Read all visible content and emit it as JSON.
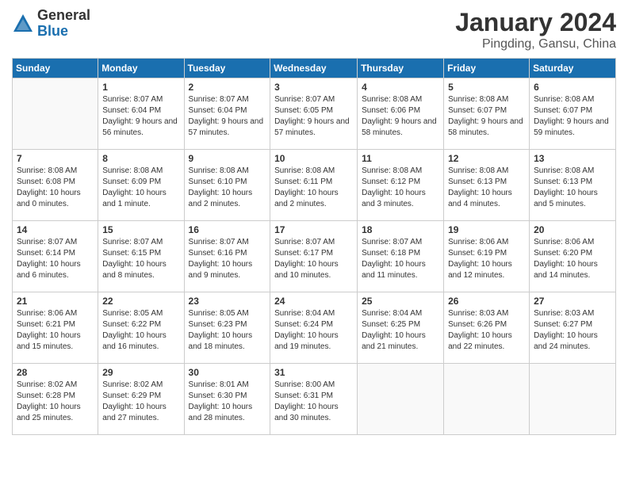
{
  "header": {
    "logo_general": "General",
    "logo_blue": "Blue",
    "title": "January 2024",
    "location": "Pingding, Gansu, China"
  },
  "weekdays": [
    "Sunday",
    "Monday",
    "Tuesday",
    "Wednesday",
    "Thursday",
    "Friday",
    "Saturday"
  ],
  "weeks": [
    [
      {
        "day": "",
        "sunrise": "",
        "sunset": "",
        "daylight": ""
      },
      {
        "day": "1",
        "sunrise": "Sunrise: 8:07 AM",
        "sunset": "Sunset: 6:04 PM",
        "daylight": "Daylight: 9 hours and 56 minutes."
      },
      {
        "day": "2",
        "sunrise": "Sunrise: 8:07 AM",
        "sunset": "Sunset: 6:04 PM",
        "daylight": "Daylight: 9 hours and 57 minutes."
      },
      {
        "day": "3",
        "sunrise": "Sunrise: 8:07 AM",
        "sunset": "Sunset: 6:05 PM",
        "daylight": "Daylight: 9 hours and 57 minutes."
      },
      {
        "day": "4",
        "sunrise": "Sunrise: 8:08 AM",
        "sunset": "Sunset: 6:06 PM",
        "daylight": "Daylight: 9 hours and 58 minutes."
      },
      {
        "day": "5",
        "sunrise": "Sunrise: 8:08 AM",
        "sunset": "Sunset: 6:07 PM",
        "daylight": "Daylight: 9 hours and 58 minutes."
      },
      {
        "day": "6",
        "sunrise": "Sunrise: 8:08 AM",
        "sunset": "Sunset: 6:07 PM",
        "daylight": "Daylight: 9 hours and 59 minutes."
      }
    ],
    [
      {
        "day": "7",
        "sunrise": "Sunrise: 8:08 AM",
        "sunset": "Sunset: 6:08 PM",
        "daylight": "Daylight: 10 hours and 0 minutes."
      },
      {
        "day": "8",
        "sunrise": "Sunrise: 8:08 AM",
        "sunset": "Sunset: 6:09 PM",
        "daylight": "Daylight: 10 hours and 1 minute."
      },
      {
        "day": "9",
        "sunrise": "Sunrise: 8:08 AM",
        "sunset": "Sunset: 6:10 PM",
        "daylight": "Daylight: 10 hours and 2 minutes."
      },
      {
        "day": "10",
        "sunrise": "Sunrise: 8:08 AM",
        "sunset": "Sunset: 6:11 PM",
        "daylight": "Daylight: 10 hours and 2 minutes."
      },
      {
        "day": "11",
        "sunrise": "Sunrise: 8:08 AM",
        "sunset": "Sunset: 6:12 PM",
        "daylight": "Daylight: 10 hours and 3 minutes."
      },
      {
        "day": "12",
        "sunrise": "Sunrise: 8:08 AM",
        "sunset": "Sunset: 6:13 PM",
        "daylight": "Daylight: 10 hours and 4 minutes."
      },
      {
        "day": "13",
        "sunrise": "Sunrise: 8:08 AM",
        "sunset": "Sunset: 6:13 PM",
        "daylight": "Daylight: 10 hours and 5 minutes."
      }
    ],
    [
      {
        "day": "14",
        "sunrise": "Sunrise: 8:07 AM",
        "sunset": "Sunset: 6:14 PM",
        "daylight": "Daylight: 10 hours and 6 minutes."
      },
      {
        "day": "15",
        "sunrise": "Sunrise: 8:07 AM",
        "sunset": "Sunset: 6:15 PM",
        "daylight": "Daylight: 10 hours and 8 minutes."
      },
      {
        "day": "16",
        "sunrise": "Sunrise: 8:07 AM",
        "sunset": "Sunset: 6:16 PM",
        "daylight": "Daylight: 10 hours and 9 minutes."
      },
      {
        "day": "17",
        "sunrise": "Sunrise: 8:07 AM",
        "sunset": "Sunset: 6:17 PM",
        "daylight": "Daylight: 10 hours and 10 minutes."
      },
      {
        "day": "18",
        "sunrise": "Sunrise: 8:07 AM",
        "sunset": "Sunset: 6:18 PM",
        "daylight": "Daylight: 10 hours and 11 minutes."
      },
      {
        "day": "19",
        "sunrise": "Sunrise: 8:06 AM",
        "sunset": "Sunset: 6:19 PM",
        "daylight": "Daylight: 10 hours and 12 minutes."
      },
      {
        "day": "20",
        "sunrise": "Sunrise: 8:06 AM",
        "sunset": "Sunset: 6:20 PM",
        "daylight": "Daylight: 10 hours and 14 minutes."
      }
    ],
    [
      {
        "day": "21",
        "sunrise": "Sunrise: 8:06 AM",
        "sunset": "Sunset: 6:21 PM",
        "daylight": "Daylight: 10 hours and 15 minutes."
      },
      {
        "day": "22",
        "sunrise": "Sunrise: 8:05 AM",
        "sunset": "Sunset: 6:22 PM",
        "daylight": "Daylight: 10 hours and 16 minutes."
      },
      {
        "day": "23",
        "sunrise": "Sunrise: 8:05 AM",
        "sunset": "Sunset: 6:23 PM",
        "daylight": "Daylight: 10 hours and 18 minutes."
      },
      {
        "day": "24",
        "sunrise": "Sunrise: 8:04 AM",
        "sunset": "Sunset: 6:24 PM",
        "daylight": "Daylight: 10 hours and 19 minutes."
      },
      {
        "day": "25",
        "sunrise": "Sunrise: 8:04 AM",
        "sunset": "Sunset: 6:25 PM",
        "daylight": "Daylight: 10 hours and 21 minutes."
      },
      {
        "day": "26",
        "sunrise": "Sunrise: 8:03 AM",
        "sunset": "Sunset: 6:26 PM",
        "daylight": "Daylight: 10 hours and 22 minutes."
      },
      {
        "day": "27",
        "sunrise": "Sunrise: 8:03 AM",
        "sunset": "Sunset: 6:27 PM",
        "daylight": "Daylight: 10 hours and 24 minutes."
      }
    ],
    [
      {
        "day": "28",
        "sunrise": "Sunrise: 8:02 AM",
        "sunset": "Sunset: 6:28 PM",
        "daylight": "Daylight: 10 hours and 25 minutes."
      },
      {
        "day": "29",
        "sunrise": "Sunrise: 8:02 AM",
        "sunset": "Sunset: 6:29 PM",
        "daylight": "Daylight: 10 hours and 27 minutes."
      },
      {
        "day": "30",
        "sunrise": "Sunrise: 8:01 AM",
        "sunset": "Sunset: 6:30 PM",
        "daylight": "Daylight: 10 hours and 28 minutes."
      },
      {
        "day": "31",
        "sunrise": "Sunrise: 8:00 AM",
        "sunset": "Sunset: 6:31 PM",
        "daylight": "Daylight: 10 hours and 30 minutes."
      },
      {
        "day": "",
        "sunrise": "",
        "sunset": "",
        "daylight": ""
      },
      {
        "day": "",
        "sunrise": "",
        "sunset": "",
        "daylight": ""
      },
      {
        "day": "",
        "sunrise": "",
        "sunset": "",
        "daylight": ""
      }
    ]
  ]
}
